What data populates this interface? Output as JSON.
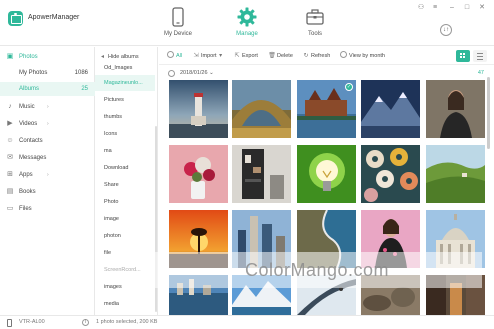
{
  "app": {
    "title": "ApowerManager"
  },
  "nav": {
    "tabs": [
      {
        "label": "My Device",
        "icon": "phone-icon",
        "active": false
      },
      {
        "label": "Manage",
        "icon": "gear-icon",
        "active": true
      },
      {
        "label": "Tools",
        "icon": "toolbox-icon",
        "active": false
      }
    ]
  },
  "window_controls": [
    "user-icon",
    "menu-icon",
    "minimize-icon",
    "maximize-icon",
    "close-icon"
  ],
  "sort_button": {
    "glyph": "↓↑"
  },
  "sidebar": {
    "photos": {
      "label": "Photos",
      "icon": "photo-icon"
    },
    "sub": [
      {
        "label": "My Photos",
        "count": "1086"
      },
      {
        "label": "Albums",
        "count": "25"
      }
    ],
    "items": [
      {
        "label": "Music",
        "icon": "music-icon"
      },
      {
        "label": "Videos",
        "icon": "video-icon"
      },
      {
        "label": "Contacts",
        "icon": "contacts-icon"
      },
      {
        "label": "Messages",
        "icon": "messages-icon"
      },
      {
        "label": "Apps",
        "icon": "apps-icon"
      },
      {
        "label": "Books",
        "icon": "book-icon"
      },
      {
        "label": "Files",
        "icon": "folder-icon"
      }
    ]
  },
  "albums": {
    "hide_label": "Hide albums",
    "items": [
      "Od_Images",
      "Magazineunlo...",
      "Pictures",
      "thumbs",
      "Icons",
      "ma",
      "Download",
      "Share",
      "Photo",
      "image",
      "photon",
      "file",
      "ScreenRcord...",
      "images",
      "media"
    ]
  },
  "toolbar": {
    "all": "All",
    "import": "Import",
    "export": "Export",
    "delete": "Delete",
    "refresh": "Refresh",
    "view_by_month": "View by month"
  },
  "date_group": {
    "date": "2018/01/26",
    "count": "47"
  },
  "photos": [
    {
      "subject": "lighthouse",
      "selected": false
    },
    {
      "subject": "stone-arch",
      "selected": false
    },
    {
      "subject": "lake-castle",
      "selected": true
    },
    {
      "subject": "snowy-mountain-night",
      "selected": false
    },
    {
      "subject": "woman-portrait",
      "selected": false
    },
    {
      "subject": "flowers-vase",
      "selected": false
    },
    {
      "subject": "shelf-interior",
      "selected": false
    },
    {
      "subject": "lightbulb",
      "selected": false
    },
    {
      "subject": "donuts",
      "selected": false
    },
    {
      "subject": "green-hills",
      "selected": false
    },
    {
      "subject": "sunset-tree",
      "selected": false
    },
    {
      "subject": "city-towers",
      "selected": false
    },
    {
      "subject": "coast-aerial",
      "selected": false
    },
    {
      "subject": "woman-flowers",
      "selected": false
    },
    {
      "subject": "domed-building",
      "selected": false
    },
    {
      "subject": "city-harbor",
      "selected": false
    },
    {
      "subject": "mountain-lake",
      "selected": false
    },
    {
      "subject": "snow-road",
      "selected": false
    },
    {
      "subject": "rocks",
      "selected": false
    },
    {
      "subject": "street-night",
      "selected": false
    }
  ],
  "watermark": {
    "text": "ColorMango.com"
  },
  "status": {
    "device": "VTR-AL00",
    "selection": "1 photo selected, 200 KB"
  },
  "colors": {
    "accent": "#2fb89a",
    "selected_bg": "#e9f7f3"
  }
}
